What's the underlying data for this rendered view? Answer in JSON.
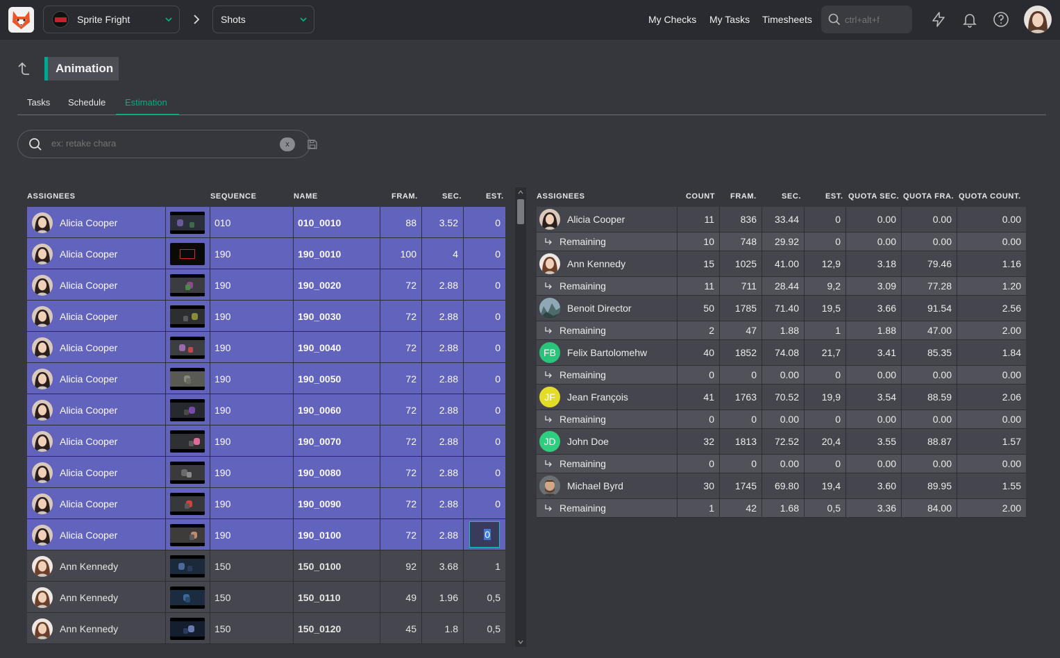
{
  "topbar": {
    "production": "Sprite Fright",
    "section": "Shots",
    "nav": [
      "My Checks",
      "My Tasks",
      "Timesheets"
    ],
    "search_placeholder": "ctrl+alt+f"
  },
  "page": {
    "title": "Animation",
    "tabs": [
      "Tasks",
      "Schedule",
      "Estimation"
    ],
    "active_tab": "Estimation",
    "filter_placeholder": "ex: retake chara",
    "clear_label": "x"
  },
  "left_table": {
    "headers": [
      "ASSIGNEES",
      "SEQUENCE",
      "NAME",
      "FRAM.",
      "SEC.",
      "EST."
    ],
    "rows": [
      {
        "assignee": "Alicia Cooper",
        "sequence": "010",
        "name": "010_0010",
        "frames": "88",
        "seconds": "3.52",
        "est": "0",
        "selected": true
      },
      {
        "assignee": "Alicia Cooper",
        "sequence": "190",
        "name": "190_0010",
        "frames": "100",
        "seconds": "4",
        "est": "0",
        "selected": true
      },
      {
        "assignee": "Alicia Cooper",
        "sequence": "190",
        "name": "190_0020",
        "frames": "72",
        "seconds": "2.88",
        "est": "0",
        "selected": true
      },
      {
        "assignee": "Alicia Cooper",
        "sequence": "190",
        "name": "190_0030",
        "frames": "72",
        "seconds": "2.88",
        "est": "0",
        "selected": true
      },
      {
        "assignee": "Alicia Cooper",
        "sequence": "190",
        "name": "190_0040",
        "frames": "72",
        "seconds": "2.88",
        "est": "0",
        "selected": true
      },
      {
        "assignee": "Alicia Cooper",
        "sequence": "190",
        "name": "190_0050",
        "frames": "72",
        "seconds": "2.88",
        "est": "0",
        "selected": true
      },
      {
        "assignee": "Alicia Cooper",
        "sequence": "190",
        "name": "190_0060",
        "frames": "72",
        "seconds": "2.88",
        "est": "0",
        "selected": true
      },
      {
        "assignee": "Alicia Cooper",
        "sequence": "190",
        "name": "190_0070",
        "frames": "72",
        "seconds": "2.88",
        "est": "0",
        "selected": true
      },
      {
        "assignee": "Alicia Cooper",
        "sequence": "190",
        "name": "190_0080",
        "frames": "72",
        "seconds": "2.88",
        "est": "0",
        "selected": true
      },
      {
        "assignee": "Alicia Cooper",
        "sequence": "190",
        "name": "190_0090",
        "frames": "72",
        "seconds": "2.88",
        "est": "0",
        "selected": true
      },
      {
        "assignee": "Alicia Cooper",
        "sequence": "190",
        "name": "190_0100",
        "frames": "72",
        "seconds": "2.88",
        "est": "0",
        "selected": true,
        "editing": true
      },
      {
        "assignee": "Ann Kennedy",
        "sequence": "150",
        "name": "150_0100",
        "frames": "92",
        "seconds": "3.68",
        "est": "1",
        "selected": false
      },
      {
        "assignee": "Ann Kennedy",
        "sequence": "150",
        "name": "150_0110",
        "frames": "49",
        "seconds": "1.96",
        "est": "0,5",
        "selected": false
      },
      {
        "assignee": "Ann Kennedy",
        "sequence": "150",
        "name": "150_0120",
        "frames": "45",
        "seconds": "1.8",
        "est": "0,5",
        "selected": false
      }
    ]
  },
  "right_table": {
    "headers": [
      "ASSIGNEES",
      "COUNT",
      "FRAM.",
      "SEC.",
      "EST.",
      "QUOTA SEC.",
      "QUOTA FRA.",
      "QUOTA COUNT."
    ],
    "remaining_label": "Remaining",
    "people": [
      {
        "name": "Alicia Cooper",
        "avatar": "photo",
        "initials": "",
        "color": "#ffffff",
        "row": [
          "11",
          "836",
          "33.44",
          "0",
          "0.00",
          "0.00",
          "0.00"
        ],
        "remaining": [
          "10",
          "748",
          "29.92",
          "0",
          "0.00",
          "0.00",
          "0.00"
        ]
      },
      {
        "name": "Ann Kennedy",
        "avatar": "photo",
        "initials": "",
        "color": "#ffffff",
        "row": [
          "15",
          "1025",
          "41.00",
          "12,9",
          "3.18",
          "79.46",
          "1.16"
        ],
        "remaining": [
          "11",
          "711",
          "28.44",
          "9,2",
          "3.09",
          "77.28",
          "1.20"
        ]
      },
      {
        "name": "Benoit Director",
        "avatar": "photo",
        "initials": "",
        "color": "#ffffff",
        "row": [
          "50",
          "1785",
          "71.40",
          "19,5",
          "3.66",
          "91.54",
          "2.56"
        ],
        "remaining": [
          "2",
          "47",
          "1.88",
          "1",
          "1.88",
          "47.00",
          "2.00"
        ]
      },
      {
        "name": "Felix Bartolomehw",
        "avatar": "initials",
        "initials": "FB",
        "color": "#29c47a",
        "row": [
          "40",
          "1852",
          "74.08",
          "21,7",
          "3.41",
          "85.35",
          "1.84"
        ],
        "remaining": [
          "0",
          "0",
          "0.00",
          "0",
          "0.00",
          "0.00",
          "0.00"
        ]
      },
      {
        "name": "Jean François",
        "avatar": "initials",
        "initials": "JF",
        "color": "#e3dd2a",
        "row": [
          "41",
          "1763",
          "70.52",
          "19,9",
          "3.54",
          "88.59",
          "2.06"
        ],
        "remaining": [
          "0",
          "0",
          "0.00",
          "0",
          "0.00",
          "0.00",
          "0.00"
        ]
      },
      {
        "name": "John Doe",
        "avatar": "initials",
        "initials": "JD",
        "color": "#2fce7e",
        "row": [
          "32",
          "1813",
          "72.52",
          "20,4",
          "3.55",
          "88.87",
          "1.57"
        ],
        "remaining": [
          "0",
          "0",
          "0.00",
          "0",
          "0.00",
          "0.00",
          "0.00"
        ]
      },
      {
        "name": "Michael Byrd",
        "avatar": "photo",
        "initials": "",
        "color": "#ffffff",
        "row": [
          "30",
          "1745",
          "69.80",
          "19,4",
          "3.60",
          "89.95",
          "1.55"
        ],
        "remaining": [
          "1",
          "42",
          "1.68",
          "0,5",
          "3.36",
          "84.00",
          "2.00"
        ]
      }
    ]
  },
  "colors": {
    "selected_row": "#6263bd",
    "accent": "#00b080",
    "background": "#36373d"
  }
}
